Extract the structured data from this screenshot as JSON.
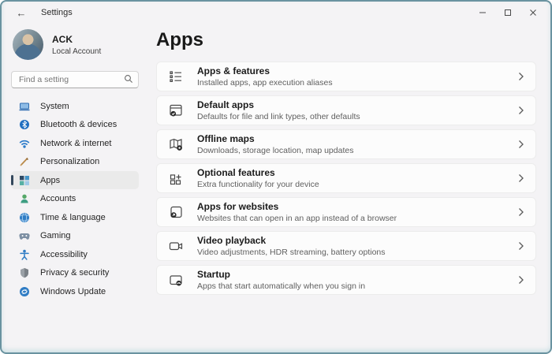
{
  "titlebar": {
    "title": "Settings",
    "back_icon": "←"
  },
  "sidebar": {
    "user": {
      "name": "ACK",
      "account_type": "Local Account"
    },
    "search": {
      "placeholder": "Find a setting"
    },
    "items": [
      {
        "label": "System",
        "icon": "system-icon",
        "selected": false
      },
      {
        "label": "Bluetooth & devices",
        "icon": "bluetooth-icon",
        "selected": false
      },
      {
        "label": "Network & internet",
        "icon": "network-icon",
        "selected": false
      },
      {
        "label": "Personalization",
        "icon": "personalization-icon",
        "selected": false
      },
      {
        "label": "Apps",
        "icon": "apps-icon",
        "selected": true
      },
      {
        "label": "Accounts",
        "icon": "accounts-icon",
        "selected": false
      },
      {
        "label": "Time & language",
        "icon": "time-language-icon",
        "selected": false
      },
      {
        "label": "Gaming",
        "icon": "gaming-icon",
        "selected": false
      },
      {
        "label": "Accessibility",
        "icon": "accessibility-icon",
        "selected": false
      },
      {
        "label": "Privacy & security",
        "icon": "privacy-icon",
        "selected": false
      },
      {
        "label": "Windows Update",
        "icon": "windows-update-icon",
        "selected": false
      }
    ]
  },
  "main": {
    "title": "Apps",
    "cards": [
      {
        "title": "Apps & features",
        "subtitle": "Installed apps, app execution aliases",
        "icon": "apps-features-icon"
      },
      {
        "title": "Default apps",
        "subtitle": "Defaults for file and link types, other defaults",
        "icon": "default-apps-icon"
      },
      {
        "title": "Offline maps",
        "subtitle": "Downloads, storage location, map updates",
        "icon": "offline-maps-icon"
      },
      {
        "title": "Optional features",
        "subtitle": "Extra functionality for your device",
        "icon": "optional-features-icon"
      },
      {
        "title": "Apps for websites",
        "subtitle": "Websites that can open in an app instead of a browser",
        "icon": "apps-websites-icon"
      },
      {
        "title": "Video playback",
        "subtitle": "Video adjustments, HDR streaming, battery options",
        "icon": "video-playback-icon"
      },
      {
        "title": "Startup",
        "subtitle": "Apps that start automatically when you sign in",
        "icon": "startup-icon"
      }
    ]
  },
  "colors": {
    "accent_bar": "#33485c",
    "window_border": "#6a93a0",
    "selected_nav_bg": "#eaeaea",
    "window_bg": "#f4f3f5",
    "card_bg": "#fcfcfc"
  }
}
